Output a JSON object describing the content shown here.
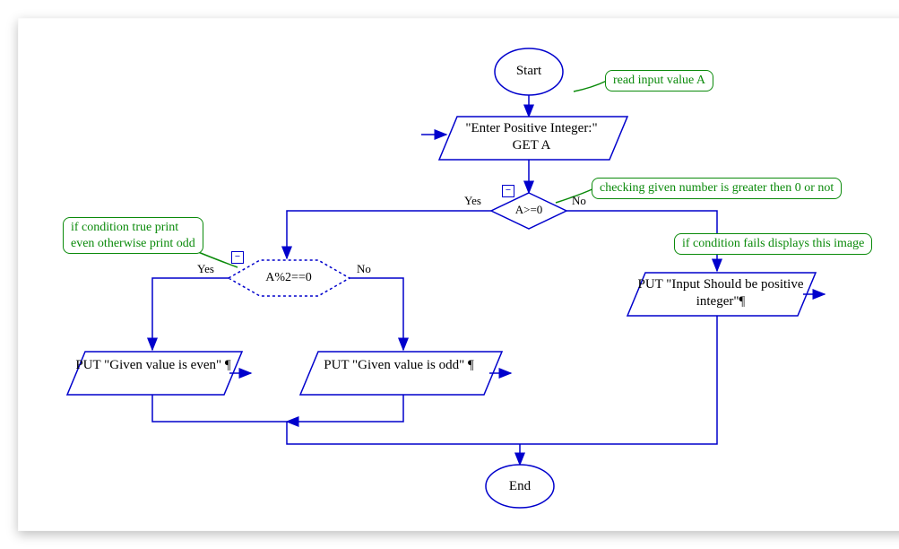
{
  "flow": {
    "start": "Start",
    "end": "End",
    "input": {
      "line1": "\"Enter Positive Integer:\"",
      "line2": "GET A"
    },
    "decision1": {
      "label": "A>=0",
      "yes": "Yes",
      "no": "No"
    },
    "decision2": {
      "label": "A%2==0",
      "yes": "Yes",
      "no": "No"
    },
    "out_even": "PUT \"Given value is even\" ¶",
    "out_odd": "PUT \"Given value is odd\" ¶",
    "out_err": "PUT \"Input Should be positive integer\"¶"
  },
  "comments": {
    "read": "read input value A",
    "check": "checking given number is greater then 0 or not",
    "evenodd_l1": "if condition true print",
    "evenodd_l2": "even otherwise print odd",
    "fails": "if condition fails displays this image"
  },
  "badge": "−"
}
